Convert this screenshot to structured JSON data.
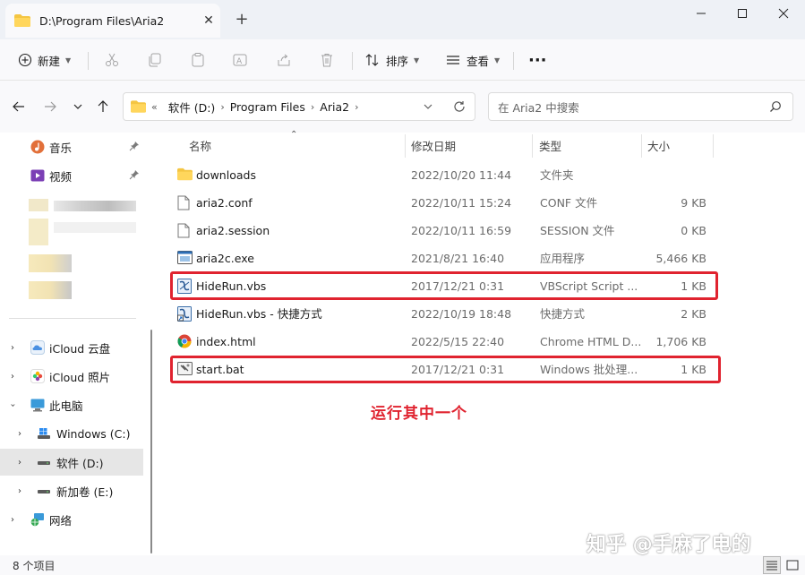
{
  "window": {
    "tab_title": "D:\\Program Files\\Aria2",
    "tab_close": "✕",
    "new_tab": "+"
  },
  "toolbar": {
    "new_label": "新建",
    "sort_label": "排序",
    "view_label": "查看",
    "more": "···"
  },
  "address": {
    "overflow": "«",
    "crumbs": [
      "软件 (D:)",
      "Program Files",
      "Aria2"
    ],
    "search_placeholder": "在 Aria2 中搜索"
  },
  "sidebar": {
    "quick": [
      {
        "label": "音乐",
        "icon": "music-icon"
      },
      {
        "label": "视频",
        "icon": "video-icon"
      }
    ],
    "tree": [
      {
        "label": "iCloud 云盘",
        "icon": "icloud-drive-icon"
      },
      {
        "label": "iCloud 照片",
        "icon": "icloud-photos-icon"
      },
      {
        "label": "此电脑",
        "icon": "this-pc-icon"
      },
      {
        "label": "Windows (C:)",
        "icon": "windows-drive-icon"
      },
      {
        "label": "软件 (D:)",
        "icon": "drive-icon"
      },
      {
        "label": "新加卷 (E:)",
        "icon": "drive-icon"
      },
      {
        "label": "网络",
        "icon": "network-icon"
      }
    ]
  },
  "columns": {
    "name": "名称",
    "date": "修改日期",
    "type": "类型",
    "size": "大小"
  },
  "files": [
    {
      "name": "downloads",
      "date": "2022/10/20 11:44",
      "type": "文件夹",
      "size": "",
      "icon": "folder-icon"
    },
    {
      "name": "aria2.conf",
      "date": "2022/10/11 15:24",
      "type": "CONF 文件",
      "size": "9 KB",
      "icon": "file-icon"
    },
    {
      "name": "aria2.session",
      "date": "2022/10/11 16:59",
      "type": "SESSION 文件",
      "size": "0 KB",
      "icon": "file-icon"
    },
    {
      "name": "aria2c.exe",
      "date": "2021/8/21 16:40",
      "type": "应用程序",
      "size": "5,466 KB",
      "icon": "exe-icon"
    },
    {
      "name": "HideRun.vbs",
      "date": "2017/12/21 0:31",
      "type": "VBScript Script ...",
      "size": "1 KB",
      "icon": "vbs-icon"
    },
    {
      "name": "HideRun.vbs - 快捷方式",
      "date": "2022/10/19 18:48",
      "type": "快捷方式",
      "size": "2 KB",
      "icon": "vbs-shortcut-icon"
    },
    {
      "name": "index.html",
      "date": "2022/5/15 22:40",
      "type": "Chrome HTML D...",
      "size": "1,706 KB",
      "icon": "chrome-icon"
    },
    {
      "name": "start.bat",
      "date": "2017/12/21 0:31",
      "type": "Windows 批处理...",
      "size": "1 KB",
      "icon": "bat-icon"
    }
  ],
  "annotation": "运行其中一个",
  "status": {
    "count": "8 个项目"
  },
  "watermark": "知乎 @手麻了电的",
  "colors": {
    "highlight": "#e0232f",
    "folder": "#f4c542"
  }
}
